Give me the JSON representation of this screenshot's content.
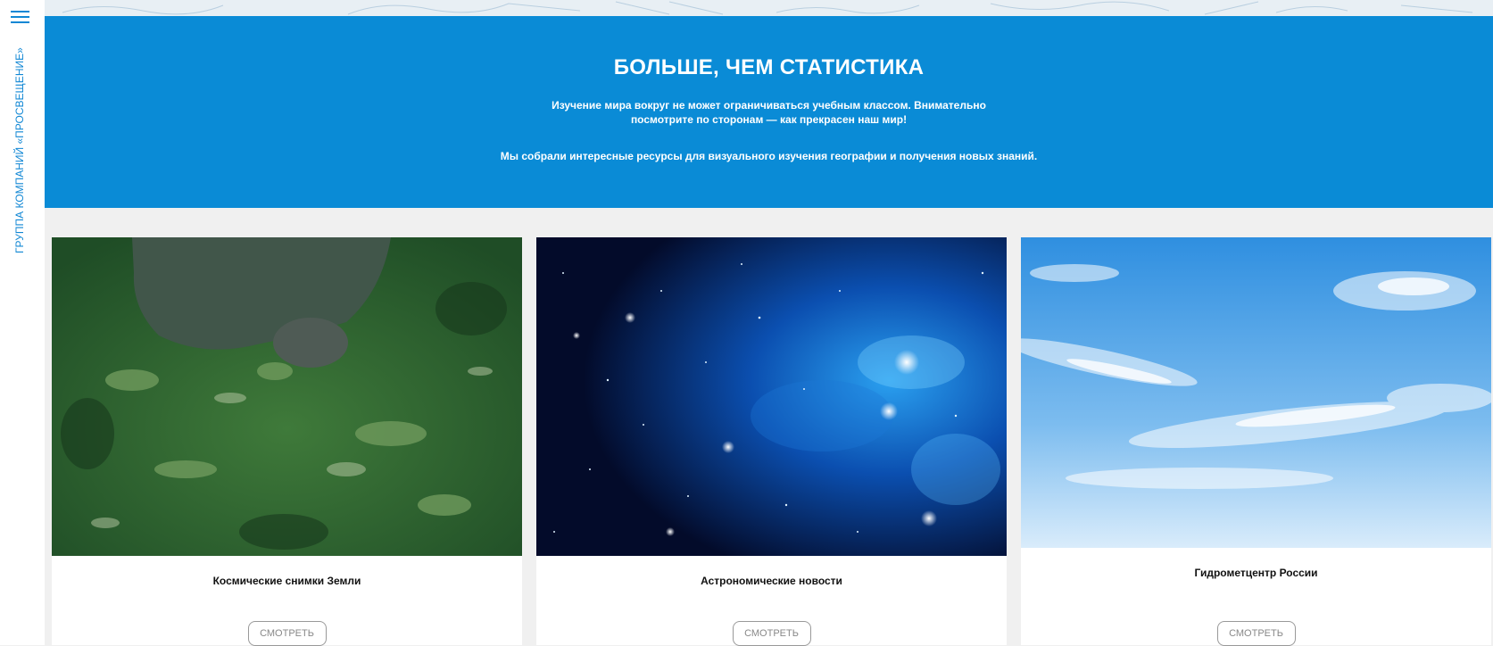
{
  "sidebar": {
    "menu_icon": "hamburger-menu-icon",
    "brand_text": "ГРУППА КОМПАНИЙ «ПРОСВЕЩЕНИЕ»"
  },
  "hero": {
    "title": "БОЛЬШЕ, ЧЕМ СТАТИСТИКА",
    "description_line1": "Изучение мира вокруг не может ограничиваться учебным классом. Внимательно посмотрите по сторонам — как прекрасен наш мир!",
    "description_line2": "Мы собрали интересные ресурсы для визуального изучения географии и получения новых знаний.",
    "background_color": "#0a8bd6"
  },
  "cards": [
    {
      "title": "Космические снимки Земли",
      "button_label": "СМОТРЕТЬ",
      "image": "satellite-earth-image"
    },
    {
      "title": "Астрономические новости",
      "button_label": "СМОТРЕТЬ",
      "image": "galaxy-nebula-image"
    },
    {
      "title": "Гидрометцентр России",
      "button_label": "СМОТРЕТЬ",
      "image": "blue-sky-clouds-image"
    }
  ],
  "colors": {
    "accent": "#1187d4",
    "page_background": "#f0f0f0"
  }
}
